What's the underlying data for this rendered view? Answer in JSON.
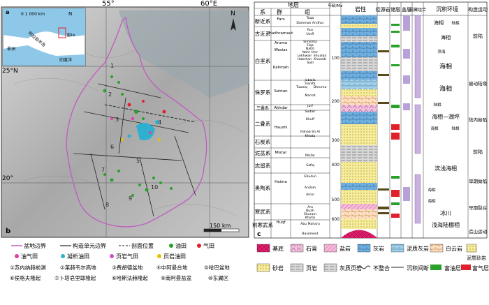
{
  "map": {
    "panel_label_a": "a",
    "panel_label_b": "b",
    "lon_labels": [
      "55°",
      "60°E"
    ],
    "lat_labels": [
      "25°N",
      "20°"
    ],
    "inset_scale": "0   1 000 km",
    "inset_places": [
      "阿拉伯半岛",
      "非洲",
      "印度洋",
      "图1b"
    ],
    "scale_bar": "150 km",
    "north": "N",
    "unit_numbers": [
      "1",
      "2",
      "3",
      "4",
      "5",
      "6",
      "7",
      "8",
      "9",
      "10"
    ]
  },
  "legend": {
    "row1": [
      "盆地边界",
      "构造单元边界",
      "剖面位置",
      "油田",
      "气田"
    ],
    "row2": [
      "油气田",
      "凝析油田",
      "页岩气田",
      "页岩油田"
    ],
    "units_row1": [
      "①苏内纳赫前渊",
      "②莱赫韦尔高地",
      "③费胡德盆地",
      "④中阿曼台地",
      "⑤哈巴盆地"
    ],
    "units_row2": [
      "⑥侯格夫隆起",
      "⑦卜塔皂里耶隆起",
      "⑧哈斯法赫隆起",
      "⑨南阿曼盐盆",
      "⑩东翼区"
    ]
  },
  "column": {
    "panel_label": "c",
    "header_group": "地层",
    "headers": [
      "系",
      "群",
      "组",
      "年龄/Ma",
      "岩性",
      "烃源岩",
      "储层",
      "盖层",
      "成藏组合",
      "沉积环境",
      "构造运动"
    ],
    "age_ticks": [
      "100",
      "200",
      "300",
      "400",
      "500",
      "600"
    ],
    "systems": [
      "新近系",
      "古近系",
      "白垩系",
      "侏罗系",
      "三叠系",
      "二叠系",
      "石炭系",
      "泥盆系",
      "志留系",
      "奥陶系",
      "寒武系",
      "前寒武系"
    ],
    "groups": [
      "Fars",
      "Hadhramaut",
      "Aruma",
      "Wasias",
      "Kahmah",
      "Sahtan",
      "Akhdar",
      "Haushi",
      "Mistar",
      "Haima",
      "Huqf"
    ],
    "formations": [
      "Taqa",
      "Damman Andhur",
      "Rus",
      "UerR",
      "Simsima",
      "Fiqa",
      "Natih",
      "Nahr Umr",
      "Lekhwair",
      "Shuaiba",
      "Kharaib",
      "Habshan",
      "Salil",
      "Jubaila",
      "Hanifa",
      "Tuwaiq",
      "Dhruma",
      "Marrat",
      "Jurf",
      "Sudair",
      "Khuff",
      "Rahab Sh Al",
      "Khlata",
      "Mistar",
      "Safiq",
      "Ghudun",
      "Andam",
      "Amin",
      "Ara",
      "Buah",
      "Shuram",
      "Khufai",
      "Abu Mahara",
      "Basement"
    ],
    "environments": [
      "海相",
      "陆相",
      "海相",
      "滨海",
      "海相",
      "海相",
      "陆相",
      "海相",
      "海相—潮坪",
      "海相",
      "陆相",
      "滨浅海相",
      "海相",
      "海相",
      "冰川",
      "浅海陆棚相"
    ],
    "tectonics": [
      "前陆",
      "被动陆缘",
      "陆内拗陷",
      "前陆",
      "早期拗陷",
      "早期裂谷",
      "造山运动"
    ]
  },
  "lith_legend": {
    "row1": [
      "基底",
      "石膏",
      "盐岩",
      "灰岩",
      "泥质灰岩",
      "白云岩",
      "泥质砂岩"
    ],
    "row2": [
      "砂岩",
      "页岩",
      "灰质页岩",
      "不整合",
      "沉积间断",
      "富油层",
      "富气层"
    ]
  },
  "colors": {
    "basin_boundary": "#c060c0",
    "oil": "#2aa02a",
    "gas": "#e0202a",
    "oilgas": "#e040a0",
    "condensate": "#30b0d0",
    "shale_gas": "#d050d0",
    "shale_oil": "#e8c000",
    "seal": "#b8a0d8",
    "sea": "#8ec8e8"
  }
}
